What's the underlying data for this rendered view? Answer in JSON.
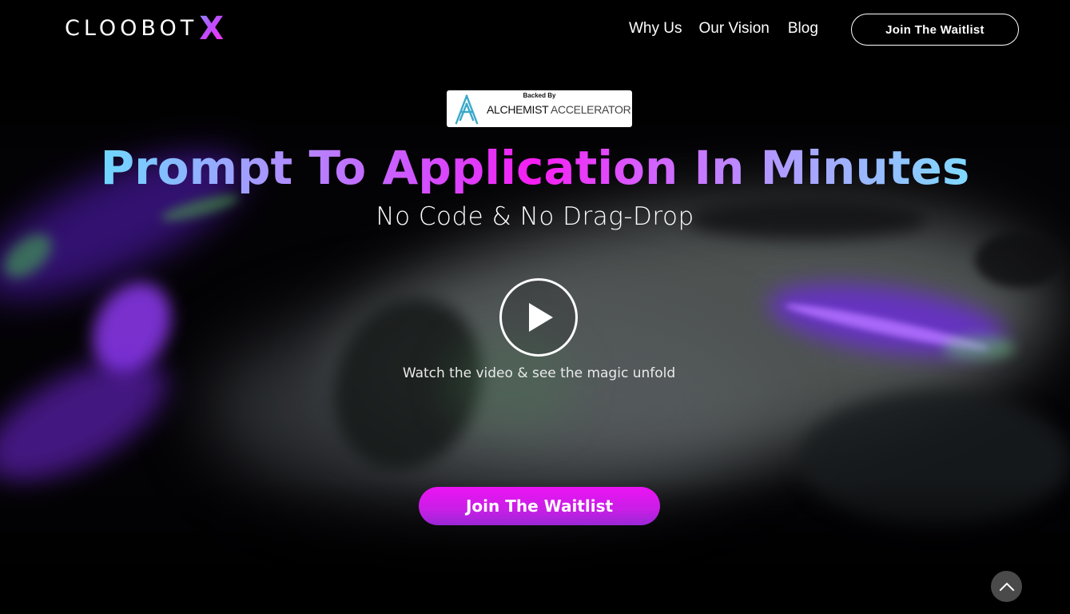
{
  "brand": {
    "name": "CLOOBOT",
    "mark": "X"
  },
  "nav": {
    "items": [
      {
        "label": "Why Us"
      },
      {
        "label": "Our Vision"
      },
      {
        "label": "Blog"
      }
    ],
    "cta_label": "Join The Waitlist"
  },
  "badge": {
    "caption": "Backed By",
    "name_primary": "ALCHEMIST",
    "name_secondary": "ACCELERATOR",
    "icon": "alchemist-logo-icon"
  },
  "hero": {
    "headline": "Prompt To Application In Minutes",
    "subheadline": "No Code & No Drag-Drop",
    "play_icon": "play-icon",
    "video_caption": "Watch the video & see the magic unfold",
    "cta_label": "Join The Waitlist"
  },
  "scroll_top": {
    "icon": "chevron-up-icon"
  },
  "colors": {
    "headline_gradient": [
      "#6fd8ff",
      "#d44dff",
      "#f51ef2",
      "#7fd9ff"
    ],
    "cta_gradient": [
      "#ec14f4",
      "#9a28d6"
    ],
    "scroll_top_bg": "#4a4a4a",
    "background": "#000000"
  }
}
